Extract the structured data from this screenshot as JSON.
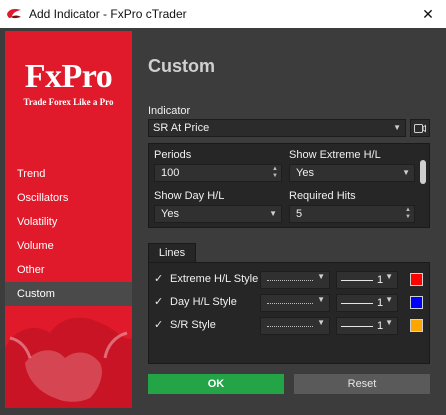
{
  "window": {
    "title": "Add Indicator - FxPro cTrader",
    "close_glyph": "✕"
  },
  "sidebar": {
    "logo": "FxPro",
    "tagline": "Trade Forex Like a Pro",
    "items": [
      {
        "label": "Trend"
      },
      {
        "label": "Oscillators"
      },
      {
        "label": "Volatility"
      },
      {
        "label": "Volume"
      },
      {
        "label": "Other"
      },
      {
        "label": "Custom",
        "active": true
      }
    ]
  },
  "main": {
    "heading": "Custom",
    "indicator_label": "Indicator",
    "indicator_value": "SR At Price",
    "params": {
      "periods_label": "Periods",
      "periods_value": "100",
      "show_extreme_label": "Show Extreme H/L",
      "show_extreme_value": "Yes",
      "show_day_label": "Show Day H/L",
      "show_day_value": "Yes",
      "required_hits_label": "Required Hits",
      "required_hits_value": "5"
    },
    "lines_tab": "Lines",
    "lines": [
      {
        "label": "Extreme H/L Style",
        "width": "1",
        "color": "#ff0000"
      },
      {
        "label": "Day H/L Style",
        "width": "1",
        "color": "#0000ff"
      },
      {
        "label": "S/R Style",
        "width": "1",
        "color": "#ffa500"
      }
    ],
    "ok_label": "OK",
    "reset_label": "Reset"
  }
}
